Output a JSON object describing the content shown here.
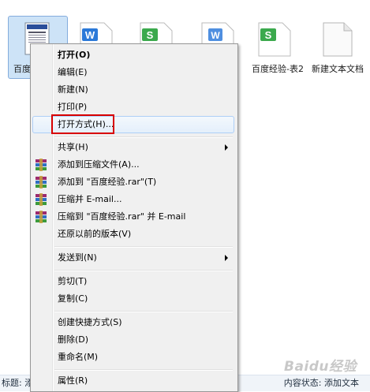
{
  "files": [
    {
      "label": "百度"
    },
    {
      "label": ""
    },
    {
      "label": ""
    },
    {
      "label": ""
    },
    {
      "label": "百度经验-表2"
    },
    {
      "label": "新建文本文档"
    }
  ],
  "context_menu": {
    "open": "打开(O)",
    "edit": "编辑(E)",
    "new": "新建(N)",
    "print": "打印(P)",
    "open_with": "打开方式(H)...",
    "share": "共享(H)",
    "add_archive": "添加到压缩文件(A)...",
    "add_rar": "添加到 \"百度经验.rar\"(T)",
    "compress_email": "压缩并 E-mail...",
    "compress_rar_email": "压缩到 \"百度经验.rar\" 并 E-mail",
    "restore": "还原以前的版本(V)",
    "send_to": "发送到(N)",
    "cut": "剪切(T)",
    "copy": "复制(C)",
    "create_shortcut": "创建快捷方式(S)",
    "delete": "删除(D)",
    "rename": "重命名(M)",
    "properties": "属性(R)"
  },
  "status_bar": {
    "left": "标题: 添",
    "right": "内容状态: 添加文本"
  },
  "watermark": "Baidu经验",
  "colors": {
    "wps_writer": "#2b79d8",
    "wps_sheet": "#3ba94d",
    "highlight_box": "#d80000",
    "selection": "#cde3f7"
  }
}
